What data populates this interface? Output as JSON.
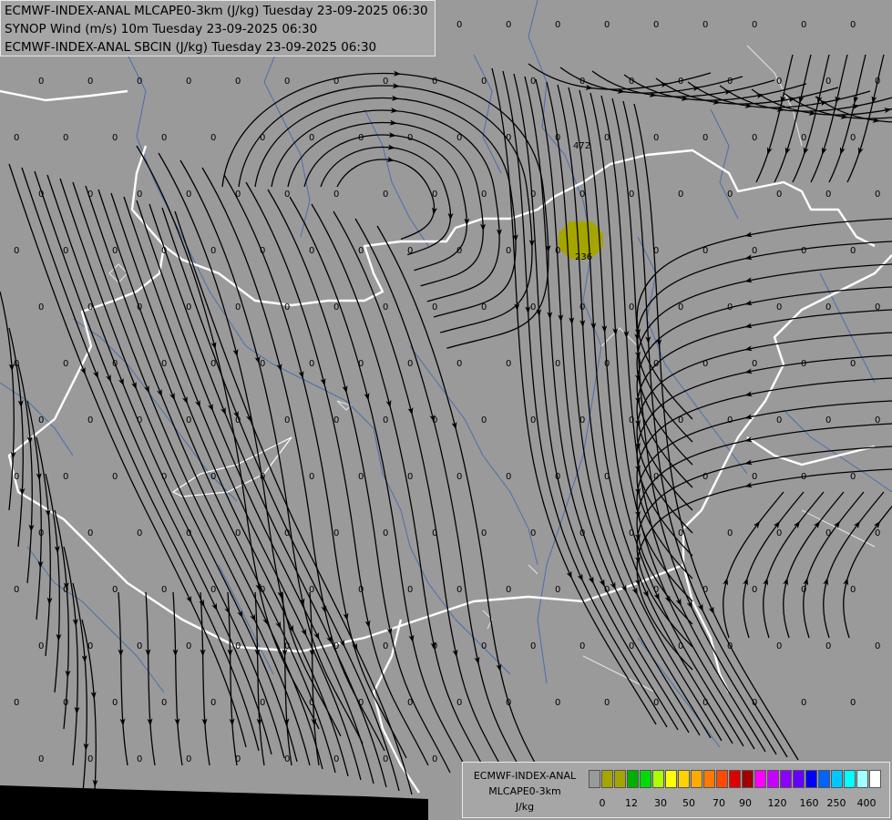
{
  "header": {
    "lines": [
      "ECMWF-INDEX-ANAL MLCAPE0-3km (J/kg) Tuesday 23-09-2025 06:30",
      "SYNOP Wind (m/s) 10m Tuesday 23-09-2025 06:30",
      "ECMWF-INDEX-ANAL SBCIN (J/kg) Tuesday 23-09-2025 06:30"
    ]
  },
  "map": {
    "field_value": "0",
    "labels": [
      {
        "text": "472",
        "id": "472"
      },
      {
        "text": "236",
        "id": "236"
      }
    ],
    "colors": {
      "background": "#9a9a9a",
      "border": "#ffffff",
      "river": "#4a6fb0",
      "streamline": "#000000",
      "cape_blob": "#a5a500",
      "coast": "#000000"
    }
  },
  "legend": {
    "title1": "ECMWF-INDEX-ANAL",
    "title2": "MLCAPE0-3km",
    "unit": "J/kg",
    "colors": [
      "#9a9a9a",
      "#a5a500",
      "#a5a500",
      "#00b000",
      "#00dc00",
      "#aaff00",
      "#ffff00",
      "#ffd200",
      "#ffaa00",
      "#ff7a00",
      "#ff4a00",
      "#dc0000",
      "#a00000",
      "#ff00ff",
      "#c800ff",
      "#8c00ff",
      "#6400ff",
      "#0000ff",
      "#0064ff",
      "#00c8ff",
      "#00ffff",
      "#a0ffff",
      "#ffffff"
    ],
    "ticks": [
      "0",
      "12",
      "30",
      "50",
      "70",
      "90",
      "120",
      "160",
      "250",
      "400"
    ]
  }
}
